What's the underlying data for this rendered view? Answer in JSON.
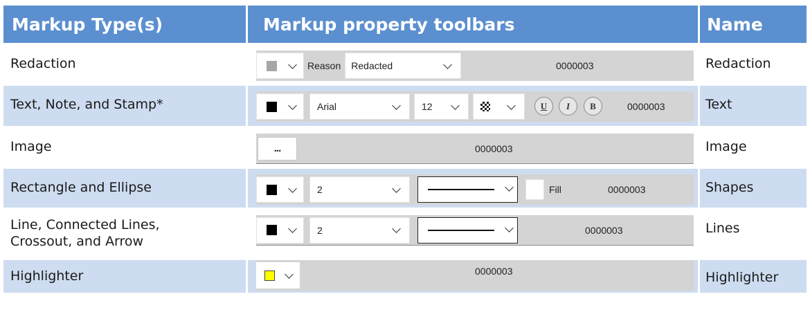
{
  "headers": {
    "type": "Markup Type(s)",
    "toolbars": "Markup property toolbars",
    "name": "Name"
  },
  "rows": [
    {
      "type": "Redaction",
      "name": "Redaction",
      "toolbar": {
        "reason_label": "Reason",
        "reason_value": "Redacted",
        "id": "0000003",
        "swatch_color": "#a6a6a6"
      }
    },
    {
      "type": "Text, Note, and Stamp*",
      "name": "Text",
      "toolbar": {
        "font": "Arial",
        "size": "12",
        "underline": "U",
        "italic": "I",
        "bold": "B",
        "id": "0000003",
        "swatch_color": "#000000"
      }
    },
    {
      "type": "Image",
      "name": "Image",
      "toolbar": {
        "browse_label": "...",
        "id": "0000003"
      }
    },
    {
      "type": "Rectangle and Ellipse",
      "name": "Shapes",
      "toolbar": {
        "width": "2",
        "fill_label": "Fill",
        "id": "0000003",
        "swatch_color": "#000000"
      }
    },
    {
      "type_line1": "Line, Connected Lines,",
      "type_line2": "Crossout, and Arrow",
      "name": "Lines",
      "toolbar": {
        "width": "2",
        "id": "0000003",
        "swatch_color": "#000000"
      }
    },
    {
      "type": "Highlighter",
      "name": "Highlighter",
      "toolbar": {
        "id": "0000003",
        "swatch_color": "#ffff00"
      }
    }
  ],
  "colors": {
    "header_bg": "#5b8fd0",
    "alt_row_bg": "#cddcf0",
    "toolbar_bg": "#d4d4d4"
  }
}
